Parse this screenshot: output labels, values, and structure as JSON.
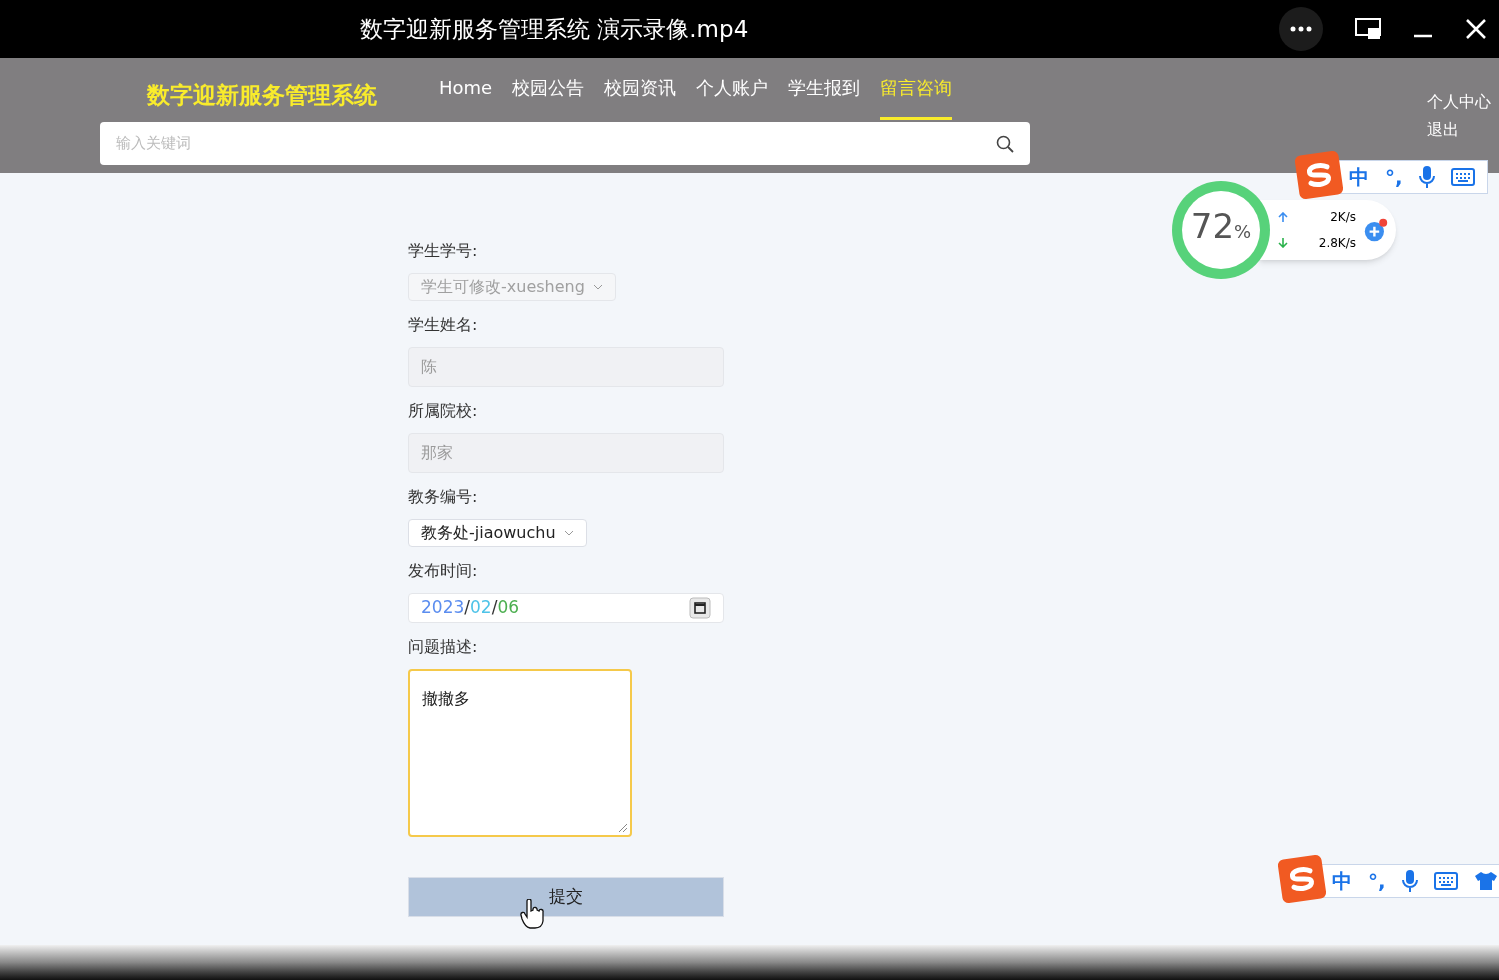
{
  "window": {
    "title": "数字迎新服务管理系统 演示录像.mp4"
  },
  "nav": {
    "brand": "数字迎新服务管理系统",
    "items": [
      {
        "label": "Home",
        "selected": false
      },
      {
        "label": "校园公告",
        "selected": false
      },
      {
        "label": "校园资讯",
        "selected": false
      },
      {
        "label": "个人账户",
        "selected": false
      },
      {
        "label": "学生报到",
        "selected": false
      },
      {
        "label": "留言咨询",
        "selected": true
      }
    ],
    "user_links": [
      "个人中心",
      "退出"
    ],
    "search": {
      "placeholder": "输入关键词"
    }
  },
  "form": {
    "fields": [
      {
        "kind": "select",
        "label": "学生学号:",
        "value": "学生可修改-xuesheng",
        "disabled": true
      },
      {
        "kind": "text",
        "label": "学生姓名:",
        "value": "陈",
        "disabled": true
      },
      {
        "kind": "text",
        "label": "所属院校:",
        "value": "那家",
        "disabled": true
      },
      {
        "kind": "select",
        "label": "教务编号:",
        "value": "教务处-jiaowuchu",
        "disabled": false
      },
      {
        "kind": "date",
        "label": "发布时间:",
        "segments": [
          {
            "text": "2023",
            "color": "#5b8def"
          },
          {
            "text": "/",
            "color": "#333333"
          },
          {
            "text": "02",
            "color": "#4fc3e8"
          },
          {
            "text": "/",
            "color": "#333333"
          },
          {
            "text": "06",
            "color": "#4caf50"
          }
        ]
      },
      {
        "kind": "textarea",
        "label": "问题描述:",
        "value": "撤撤多",
        "focused": true
      }
    ],
    "submit": "提交"
  },
  "speed_widget": {
    "percent": "72",
    "unit": "%",
    "upload": "2K/s",
    "download": "2.8K/s"
  },
  "ime_bars": [
    {
      "mode": "中",
      "punct": "°,",
      "skin": false
    },
    {
      "mode": "中",
      "punct": "°,",
      "skin": true
    }
  ]
}
